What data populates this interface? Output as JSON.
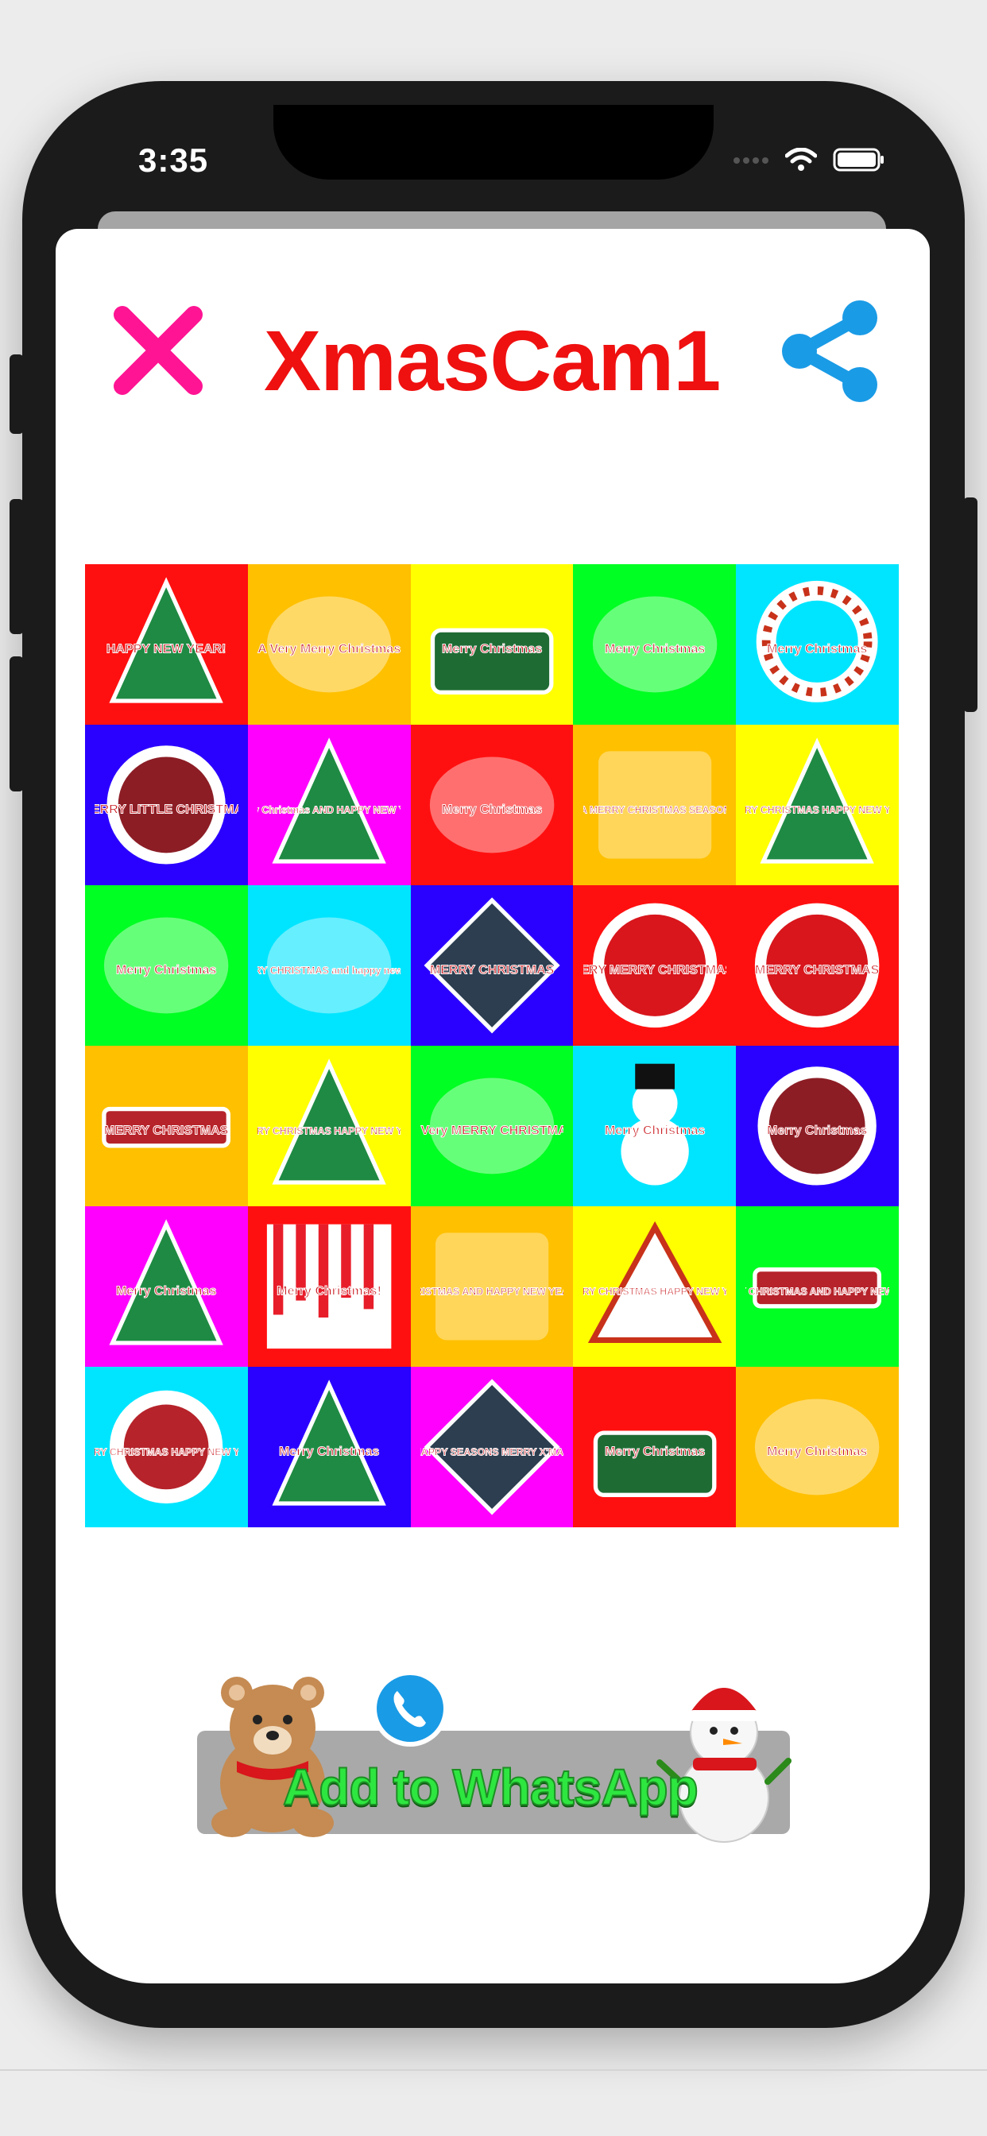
{
  "status_bar": {
    "time": "3:35"
  },
  "header": {
    "title": "XmasCam1",
    "close_icon": "close-icon",
    "share_icon": "share-icon"
  },
  "colors": {
    "close": "#ff1493",
    "title": "#ef1010",
    "share": "#1a9be6",
    "whatsapp_text": "#2ee640"
  },
  "stickers": [
    {
      "bg": "#ff1010",
      "text": "HAPPY NEW YEAR!"
    },
    {
      "bg": "#ffc000",
      "text": "A Very Merry Christmas"
    },
    {
      "bg": "#ffff00",
      "text": "Merry Christmas"
    },
    {
      "bg": "#00ff22",
      "text": "Merry Christmas"
    },
    {
      "bg": "#00e5ff",
      "text": "Merry Christmas"
    },
    {
      "bg": "#2a00ff",
      "text": "MERRY LITTLE CHRISTMAS"
    },
    {
      "bg": "#ff00ff",
      "text": "Merry Christmas AND HAPPY NEW YEAR"
    },
    {
      "bg": "#ff1010",
      "text": "Merry Christmas"
    },
    {
      "bg": "#ffc000",
      "text": "WE WISH YOU A MERRY CHRISTMAS SEASON'S GREETINGS"
    },
    {
      "bg": "#ffff00",
      "text": "MERRY CHRISTMAS HAPPY NEW YEAR"
    },
    {
      "bg": "#00ff22",
      "text": "Merry Christmas"
    },
    {
      "bg": "#00e5ff",
      "text": "MERRY CHRISTMAS and happy new year"
    },
    {
      "bg": "#2a00ff",
      "text": "MERRY CHRISTMAS"
    },
    {
      "bg": "#ff1010",
      "text": "VERY MERRY CHRISTMAS!"
    },
    {
      "bg": "#ff1010",
      "text": "MERRY CHRISTMAS"
    },
    {
      "bg": "#ffc000",
      "text": "MERRY CHRISTMAS"
    },
    {
      "bg": "#ffff00",
      "text": "MERRY CHRISTMAS HAPPY NEW YEAR"
    },
    {
      "bg": "#00ff22",
      "text": "A Very MERRY CHRISTMAS"
    },
    {
      "bg": "#00e5ff",
      "text": "Merry Christmas"
    },
    {
      "bg": "#2a00ff",
      "text": "Merry Christmas"
    },
    {
      "bg": "#ff00ff",
      "text": "Merry Christmas"
    },
    {
      "bg": "#ff1010",
      "text": "Merry Christmas!"
    },
    {
      "bg": "#ffc000",
      "text": "MERRY CHRISTMAS AND HAPPY NEW YEAR FOR ALL"
    },
    {
      "bg": "#ffff00",
      "text": "MERRY CHRISTMAS HAPPY NEW YEAR"
    },
    {
      "bg": "#00ff22",
      "text": "MERRY CHRISTMAS AND HAPPY NEW YEAR"
    },
    {
      "bg": "#00e5ff",
      "text": "MERRY CHRISTMAS HAPPY NEW YEAR"
    },
    {
      "bg": "#2a00ff",
      "text": "Merry Christmas"
    },
    {
      "bg": "#ff00ff",
      "text": "HAPPY SEASONS MERRY X'MAS"
    },
    {
      "bg": "#ff1010",
      "text": "Merry Christmas"
    },
    {
      "bg": "#ffc000",
      "text": "Merry Christmas"
    }
  ],
  "whatsapp_button": {
    "label": "Add to WhatsApp"
  }
}
